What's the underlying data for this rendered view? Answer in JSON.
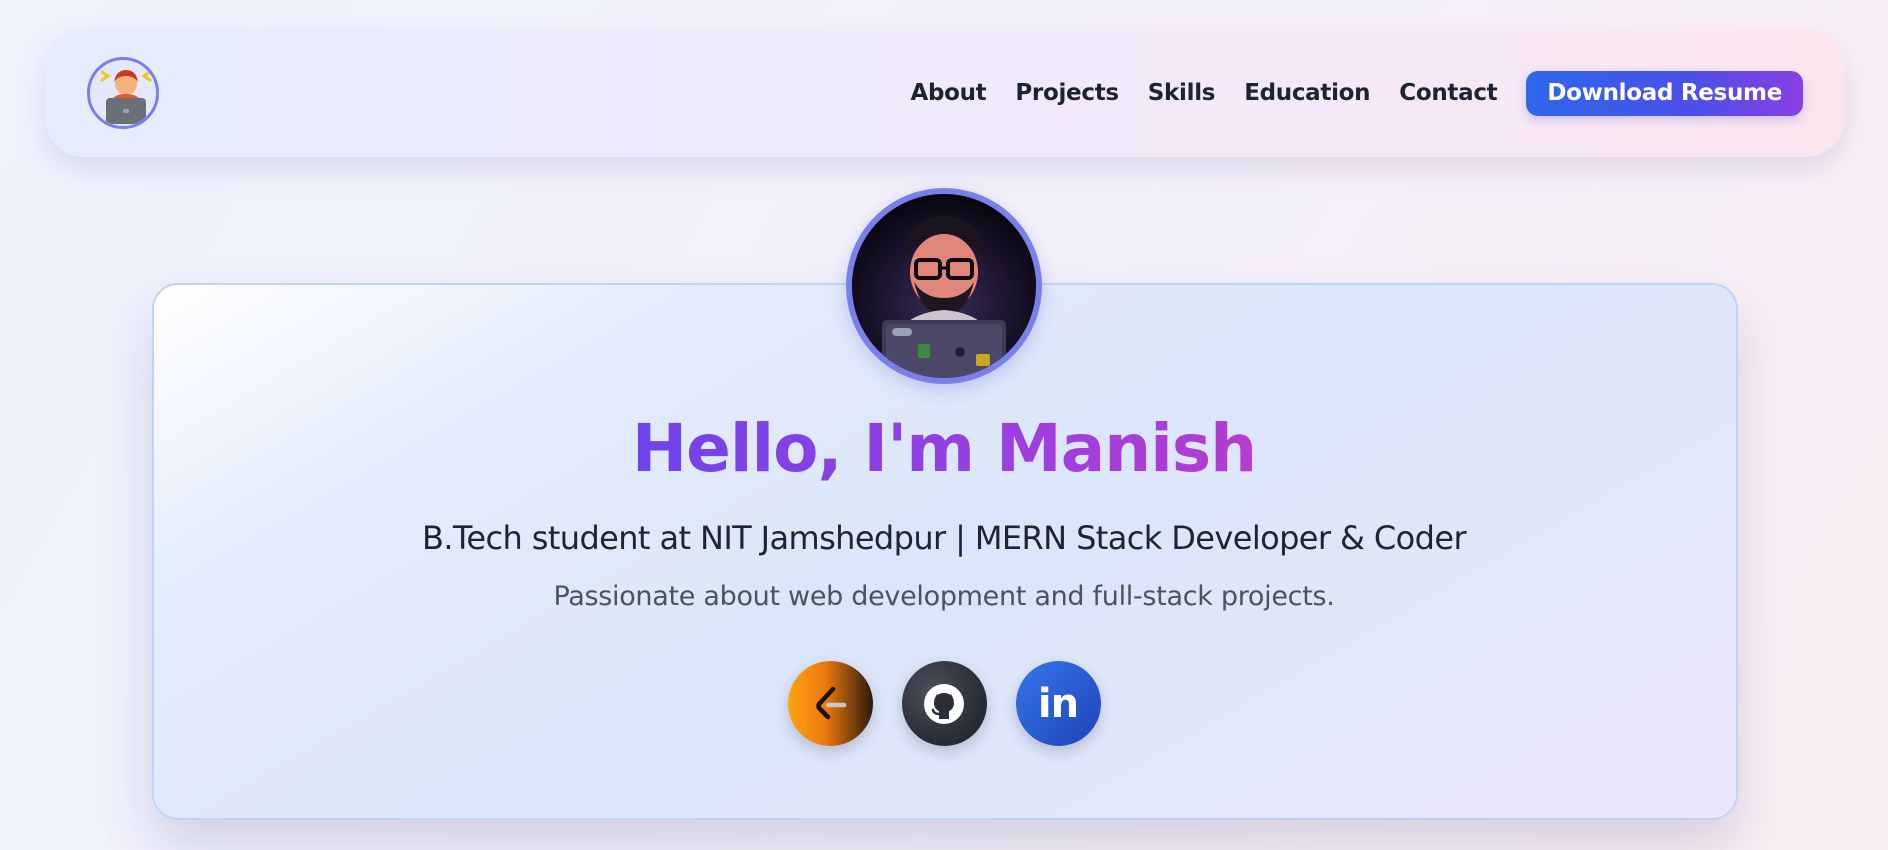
{
  "navbar": {
    "logo_icon": "developer-avatar-logo-icon",
    "links": [
      {
        "label": "About"
      },
      {
        "label": "Projects"
      },
      {
        "label": "Skills"
      },
      {
        "label": "Education"
      },
      {
        "label": "Contact"
      }
    ],
    "resume_button": "Download Resume"
  },
  "hero": {
    "avatar_icon": "developer-avatar-portrait",
    "title": "Hello, I'm Manish",
    "subtitle": "B.Tech student at NIT Jamshedpur | MERN Stack Developer & Coder",
    "tagline": "Passionate about web development and full-stack projects.",
    "socials": [
      {
        "name": "leetcode",
        "icon": "leetcode-icon"
      },
      {
        "name": "github",
        "icon": "github-icon"
      },
      {
        "name": "linkedin",
        "icon": "linkedin-icon",
        "glyph": "in"
      }
    ]
  },
  "colors": {
    "accent_blue": "#2d67ec",
    "accent_purple": "#8a3fe4",
    "title_gradient_start": "#6f43ea",
    "title_gradient_end": "#b53ccf",
    "avatar_ring": "#7a80ea",
    "card_border": "#bfd4f7",
    "text_dark": "#1f2433",
    "text_muted": "#4b5263"
  }
}
